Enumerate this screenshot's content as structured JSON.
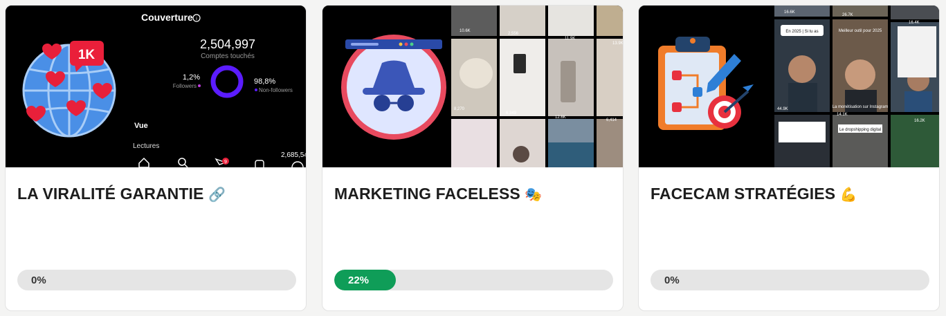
{
  "cards": [
    {
      "title": "LA VIRALITÉ GARANTIE",
      "emoji": "🔗",
      "progress": 0,
      "progress_label": "0%",
      "thumbnail": {
        "badge": "1K",
        "header": "Couverture",
        "info_icon": "i",
        "reach_value": "2,504,997",
        "reach_label": "Comptes touchés",
        "followers_pct": "1,2%",
        "followers_label": "Followers",
        "nonfollowers_pct": "98,8%",
        "nonfollowers_label": "Non-followers",
        "vue_label": "Vue",
        "lectures_label": "Lectures",
        "lectures_value": "2,685,54",
        "notif_count": "9",
        "donut_color": "#5b1cff"
      }
    },
    {
      "title": "MARKETING FACELESS",
      "emoji": "🎭",
      "progress": 22,
      "progress_label": "22%",
      "thumbnail": {
        "view_counts": [
          "10.6K",
          "2,556",
          "11.9K",
          "13.9K",
          "8,270",
          "6,349",
          "12.6K",
          "6,414"
        ]
      }
    },
    {
      "title": "FACECAM STRATÉGIES",
      "emoji": "💪",
      "progress": 0,
      "progress_label": "0%",
      "thumbnail": {
        "view_counts": [
          "16.6K",
          "26.7K",
          "16.4K",
          "44.9K",
          "14.1K",
          "16.2K"
        ],
        "captions": [
          "En 2025 | Si tu as",
          "Meilleur outil pour 2025",
          "La monétisation sur Instagram",
          "Le dropshipping digital"
        ]
      }
    }
  ],
  "colors": {
    "progress_fill": "#0f9d58",
    "progress_track": "#e5e5e5",
    "card_bg": "#ffffff",
    "page_bg": "#f4f4f3"
  }
}
